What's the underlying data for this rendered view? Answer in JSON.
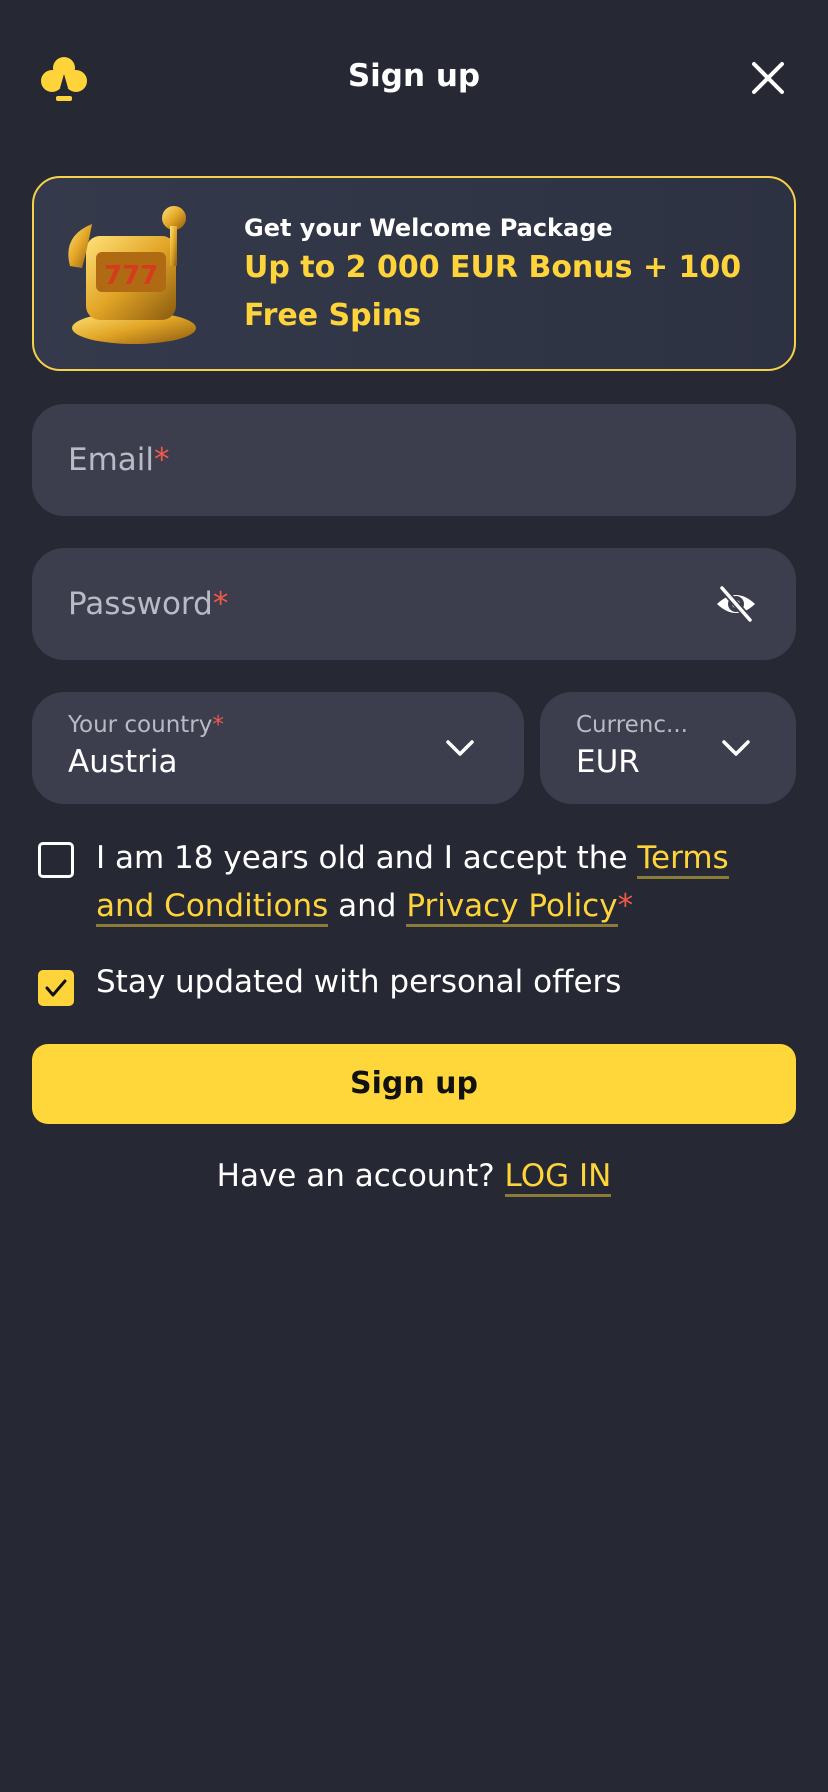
{
  "header": {
    "title": "Sign up",
    "logo_icon": "club-icon",
    "close_icon": "close-icon"
  },
  "banner": {
    "image": "slot-machine-icon",
    "kicker": "Get your Welcome Package",
    "headline": "Up to 2 000 EUR Bonus + 100 Free Spins"
  },
  "form": {
    "email_placeholder": "Email",
    "password_placeholder": "Password",
    "required_mark": "*",
    "password_toggle_icon": "eye-off-icon",
    "country": {
      "label": "Your country",
      "value": "Austria"
    },
    "currency": {
      "label": "Currenc...",
      "value": "EUR"
    },
    "terms": {
      "prefix": "I am 18 years old and I accept the",
      "terms_link": "Terms and Conditions",
      "conjunction": "and",
      "privacy_link": "Privacy Policy",
      "checked": false
    },
    "offers": {
      "label": "Stay updated with personal offers",
      "checked": true
    },
    "submit_label": "Sign up"
  },
  "footer": {
    "prompt": "Have an account?",
    "login_link": "LOG IN"
  },
  "colors": {
    "background": "#262834",
    "accent": "#ffd43b",
    "field": "#3c3e4d",
    "required": "#f05a4a"
  }
}
